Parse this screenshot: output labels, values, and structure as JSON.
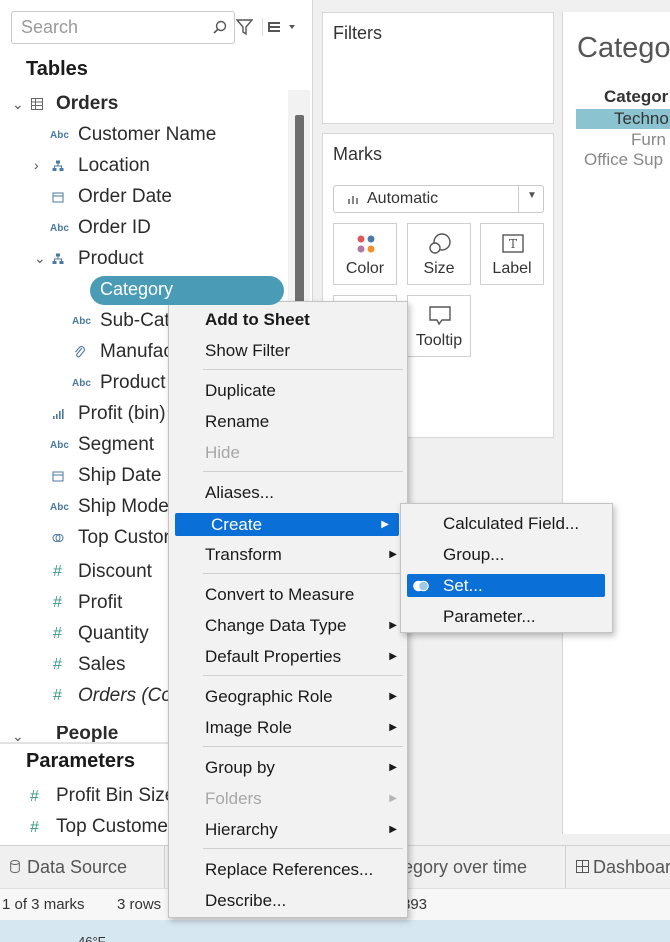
{
  "data_pane": {
    "search_placeholder": "Search",
    "tables_title": "Tables",
    "orders_label": "Orders",
    "fields": [
      {
        "type": "Abc",
        "label": "Customer Name"
      },
      {
        "type": "hier",
        "label": "Location"
      },
      {
        "type": "date",
        "label": "Order Date"
      },
      {
        "type": "Abc",
        "label": "Order ID"
      },
      {
        "type": "hier",
        "label": "Product"
      },
      {
        "type": "Abc",
        "label": "Category"
      },
      {
        "type": "Abc",
        "label": "Sub-Cat"
      },
      {
        "type": "clip",
        "label": "Manufac"
      },
      {
        "type": "Abc",
        "label": "Product"
      },
      {
        "type": "bin",
        "label": "Profit (bin)"
      },
      {
        "type": "Abc",
        "label": "Segment"
      },
      {
        "type": "date",
        "label": "Ship Date"
      },
      {
        "type": "Abc",
        "label": "Ship Mode"
      },
      {
        "type": "set",
        "label": "Top Custor"
      },
      {
        "type": "#",
        "label": "Discount"
      },
      {
        "type": "#",
        "label": "Profit"
      },
      {
        "type": "#",
        "label": "Quantity"
      },
      {
        "type": "#",
        "label": "Sales"
      },
      {
        "type": "#",
        "label": "Orders (Co"
      }
    ],
    "people_label": "People",
    "parameters_title": "Parameters",
    "parameters": [
      "Profit Bin Size",
      "Top Custome"
    ]
  },
  "shelves": {
    "filters_title": "Filters",
    "marks_title": "Marks",
    "mark_type": "Automatic",
    "mark_buttons": [
      "Color",
      "Size",
      "Label",
      "Tooltip"
    ]
  },
  "view": {
    "title": "Catego",
    "header": "Categor",
    "rows": [
      "Techno",
      "Furn",
      "Office Sup"
    ]
  },
  "tabs": [
    "Data Source",
    "tegory over time",
    "Dashboar"
  ],
  "status": {
    "marks": "1 of 3 marks",
    "rows": "3 rows",
    "sum": "893"
  },
  "taskbar": {
    "weather": "46°F"
  },
  "context_menu": {
    "items": [
      {
        "label": "Add to Sheet",
        "style": "bold"
      },
      {
        "label": "Show Filter"
      },
      {
        "label": "Duplicate"
      },
      {
        "label": "Rename"
      },
      {
        "label": "Hide",
        "style": "disabled"
      },
      {
        "label": "Aliases..."
      },
      {
        "label": "Create",
        "submenu": true,
        "style": "highlight"
      },
      {
        "label": "Transform",
        "submenu": true
      },
      {
        "label": "Convert to Measure"
      },
      {
        "label": "Change Data Type",
        "submenu": true
      },
      {
        "label": "Default Properties",
        "submenu": true
      },
      {
        "label": "Geographic Role",
        "submenu": true
      },
      {
        "label": "Image Role",
        "submenu": true
      },
      {
        "label": "Group by",
        "submenu": true
      },
      {
        "label": "Folders",
        "submenu": true,
        "style": "disabled"
      },
      {
        "label": "Hierarchy",
        "submenu": true
      },
      {
        "label": "Replace References..."
      },
      {
        "label": "Describe..."
      }
    ]
  },
  "create_submenu": {
    "items": [
      {
        "label": "Calculated Field..."
      },
      {
        "label": "Group..."
      },
      {
        "label": "Set...",
        "style": "highlight"
      },
      {
        "label": "Parameter..."
      }
    ]
  },
  "colors": {
    "accent": "#0a6fd6",
    "pill": "#4a9bb5",
    "view_highlight": "#8cc3d1"
  }
}
